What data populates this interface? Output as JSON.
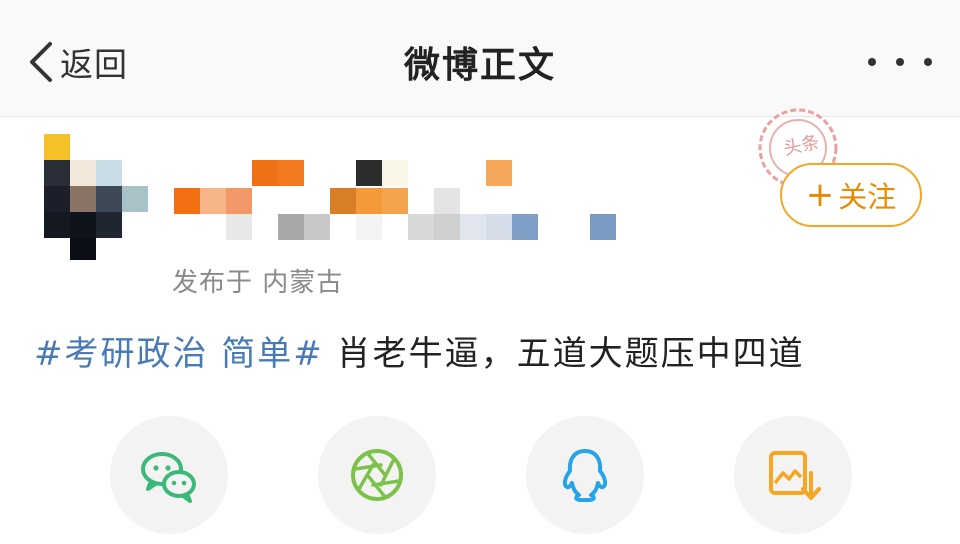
{
  "header": {
    "back_label": "返回",
    "title": "微博正文"
  },
  "post": {
    "meta": "发布于 内蒙古",
    "hashtag": "#考研政治 简单#",
    "text": " 肖老牛逼，五道大题压中四道"
  },
  "follow_button": {
    "plus": "+",
    "label": "关注"
  },
  "stamp": {
    "text": "头条"
  },
  "share_targets": [
    {
      "icon": "wechat-icon",
      "color": "#3cb878"
    },
    {
      "icon": "moments-icon",
      "color": "#7cc24a"
    },
    {
      "icon": "qq-icon",
      "color": "#27a4e8"
    },
    {
      "icon": "save-image-icon",
      "color": "#f5a623"
    }
  ],
  "colors": {
    "accent": "#f5a623",
    "hashtag": "#4a7ab5"
  }
}
